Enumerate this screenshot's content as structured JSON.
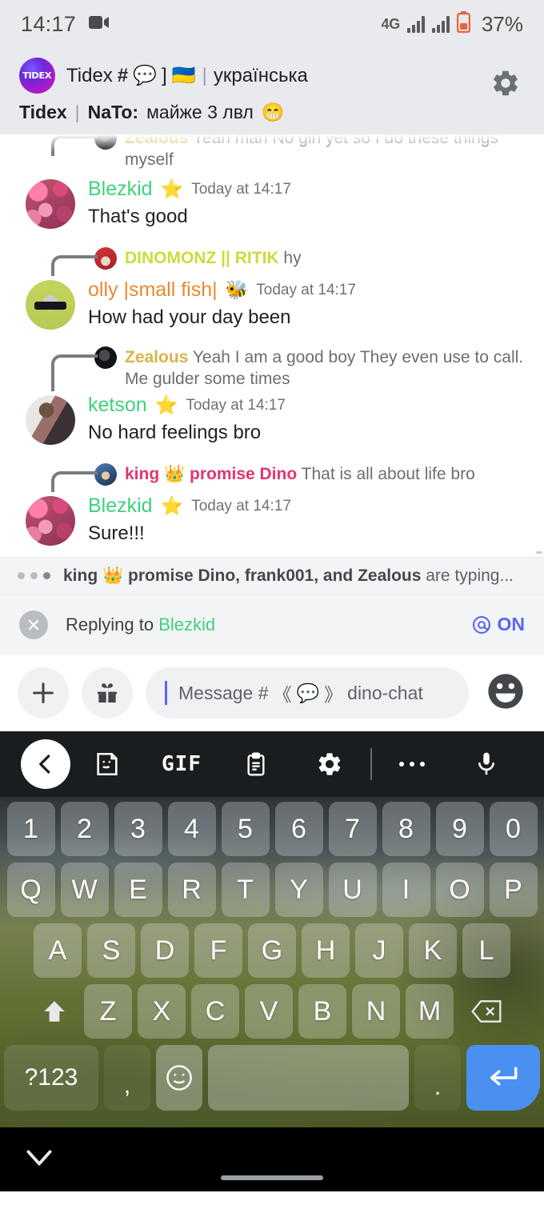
{
  "status_bar": {
    "time": "14:17",
    "network": "4G",
    "battery_percent": "37%",
    "video_icon": "video-camera-icon"
  },
  "header": {
    "server_initials": "TIDEX",
    "title_prefix": "Tidex",
    "hash": "#",
    "channel_emoji": "💬",
    "bracket": "]",
    "flag": "🇺🇦",
    "divider": "|",
    "channel_name": "українська",
    "sub_server": "Tidex",
    "sub_divider": "|",
    "sub_user": "NaTo:",
    "sub_text": "майже 3 лвл",
    "sub_emoji": "😁",
    "settings_icon": "gear-icon"
  },
  "messages": [
    {
      "reply": {
        "author": "Zealous",
        "author_color": "#d9b44a",
        "body": "Yeah man No girl yet so I do these things myself"
      },
      "author": "Blezkid",
      "author_color": "#3fd17a",
      "badge": "⭐",
      "timestamp": "Today at 14:17",
      "text": "That's good",
      "avatar": "av-blezkid"
    },
    {
      "reply": {
        "author": "DINOMONZ || RITIK",
        "author_color": "#ccdb3a",
        "body": "hy"
      },
      "author": "olly |small fish|",
      "author_color": "#e8892f",
      "badge": "🐝",
      "timestamp": "Today at 14:17",
      "text": "How had your day been",
      "avatar": "av-olly"
    },
    {
      "reply": {
        "author": "Zealous",
        "author_color": "#d9b44a",
        "body": "Yeah  I am a good boy They even use to call. Me gulder some times"
      },
      "author": "ketson",
      "author_color": "#3fd17a",
      "badge": "⭐",
      "timestamp": "Today at 14:17",
      "text": "No hard feelings bro",
      "avatar": "av-ketson"
    },
    {
      "reply": {
        "author": "king 👑 promise Dino",
        "author_color": "#e0366f",
        "body": "That is all about life bro"
      },
      "author": "Blezkid",
      "author_color": "#3fd17a",
      "badge": "⭐",
      "timestamp": "Today at 14:17",
      "text": "Sure!!!",
      "avatar": "av-blezkid"
    }
  ],
  "typing": {
    "names": "king 👑 promise Dino, frank001, and Zealous",
    "suffix": " are typing..."
  },
  "reply_bar": {
    "close_icon": "close-icon",
    "label": "Replying to",
    "target": "Blezkid",
    "mention_icon": "at-icon",
    "mention_state": "ON"
  },
  "composer": {
    "add_icon": "plus-icon",
    "gift_icon": "gift-icon",
    "placeholder_prefix": "Message #",
    "placeholder_open": "《",
    "placeholder_emoji": "💬",
    "placeholder_close": "》",
    "placeholder_channel": "dino-chat",
    "emoji_icon": "emoji-face-icon"
  },
  "keyboard": {
    "toolbar": [
      {
        "name": "back-icon",
        "label": ""
      },
      {
        "name": "sticker-icon",
        "label": ""
      },
      {
        "name": "gif-icon",
        "label": "GIF"
      },
      {
        "name": "clipboard-icon",
        "label": ""
      },
      {
        "name": "keyboard-settings-icon",
        "label": ""
      },
      {
        "name": "more-options-icon",
        "label": ""
      },
      {
        "name": "microphone-icon",
        "label": ""
      }
    ],
    "rows": [
      [
        "1",
        "2",
        "3",
        "4",
        "5",
        "6",
        "7",
        "8",
        "9",
        "0"
      ],
      [
        "Q",
        "W",
        "E",
        "R",
        "T",
        "Y",
        "U",
        "I",
        "O",
        "P"
      ],
      [
        "A",
        "S",
        "D",
        "F",
        "G",
        "H",
        "J",
        "K",
        "L"
      ],
      [
        "Z",
        "X",
        "C",
        "V",
        "B",
        "N",
        "M"
      ]
    ],
    "shift_icon": "shift-arrow-icon",
    "backspace_icon": "backspace-icon",
    "symbols_key": "?123",
    "comma_key": ",",
    "emoji_key_icon": "smiley-icon",
    "period_key": ".",
    "enter_icon": "enter-arrow-icon"
  },
  "navbar": {
    "collapse_icon": "chevron-down-icon",
    "home_indicator": "home-pill"
  }
}
